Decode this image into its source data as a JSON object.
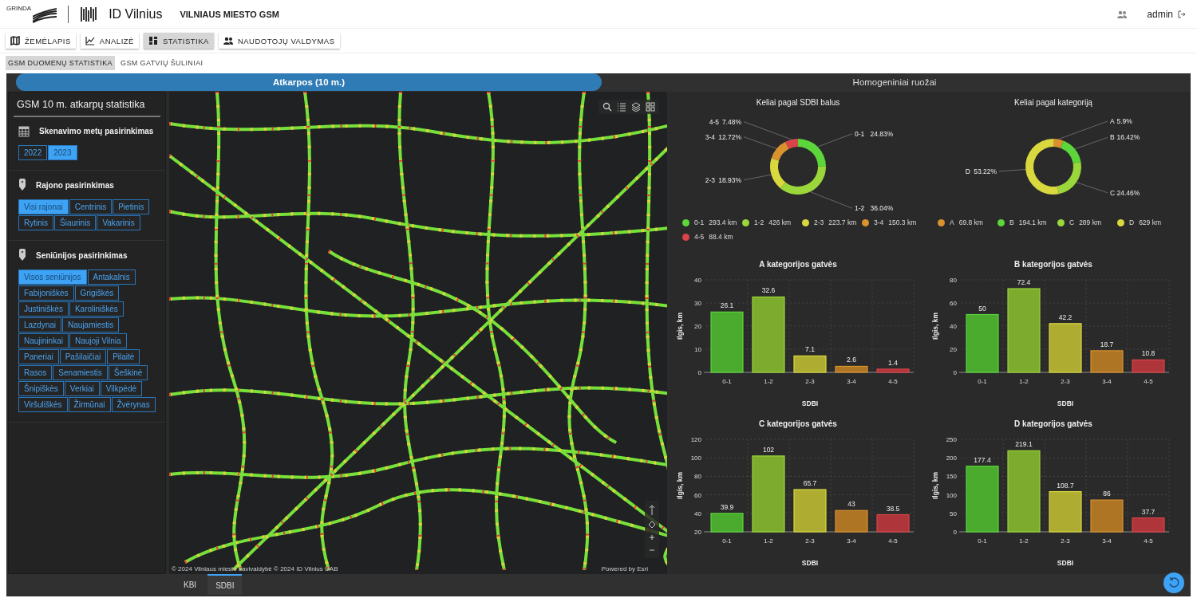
{
  "header": {
    "logo_text": "GRINDA",
    "brand": "ID Vilnius",
    "title": "VILNIAUS MIESTO GSM",
    "user": "admin"
  },
  "nav": [
    {
      "label": "ŽEMĖLAPIS",
      "selected": false
    },
    {
      "label": "ANALIZĖ",
      "selected": false
    },
    {
      "label": "STATISTIKA",
      "selected": true
    },
    {
      "label": "NAUDOTOJŲ VALDYMAS",
      "selected": false
    }
  ],
  "subtabs": [
    {
      "label": "GSM DUOMENŲ STATISTIKA",
      "selected": true
    },
    {
      "label": "GSM GATVIŲ ŠULINIAI",
      "selected": false
    }
  ],
  "view_tabs": [
    {
      "label": "Atkarpos (10 m.)",
      "selected": true
    },
    {
      "label": "Homogeniniai ruožai",
      "selected": false
    }
  ],
  "sidebar": {
    "title": "GSM 10 m. atkarpų statistika",
    "sections": [
      {
        "kind": "calendar",
        "heading": "Skenavimo metų pasirinkimas",
        "options": [
          {
            "label": "2022",
            "selected": false
          },
          {
            "label": "2023",
            "selected": true
          }
        ]
      },
      {
        "kind": "pin",
        "heading": "Rajono pasirinkimas",
        "options": [
          {
            "label": "Visi rajonai",
            "selected": true
          },
          {
            "label": "Centrinis",
            "selected": false
          },
          {
            "label": "Pietinis",
            "selected": false
          },
          {
            "label": "Rytinis",
            "selected": false
          },
          {
            "label": "Šiaurinis",
            "selected": false
          },
          {
            "label": "Vakarinis",
            "selected": false
          }
        ]
      },
      {
        "kind": "pin",
        "heading": "Seniūnijos pasirinkimas",
        "options": [
          {
            "label": "Visos seniūnijos",
            "selected": true
          },
          {
            "label": "Antakalnis",
            "selected": false
          },
          {
            "label": "Fabijoniškės",
            "selected": false
          },
          {
            "label": "Grigiškės",
            "selected": false
          },
          {
            "label": "Justiniškės",
            "selected": false
          },
          {
            "label": "Karoliniškės",
            "selected": false
          },
          {
            "label": "Lazdynai",
            "selected": false
          },
          {
            "label": "Naujamiestis",
            "selected": false
          },
          {
            "label": "Naujininkai",
            "selected": false
          },
          {
            "label": "Naujoji Vilnia",
            "selected": false
          },
          {
            "label": "Paneriai",
            "selected": false
          },
          {
            "label": "Pašilaičiai",
            "selected": false
          },
          {
            "label": "Pilaitė",
            "selected": false
          },
          {
            "label": "Rasos",
            "selected": false
          },
          {
            "label": "Senamiestis",
            "selected": false
          },
          {
            "label": "Šeškinė",
            "selected": false
          },
          {
            "label": "Šnipiškės",
            "selected": false
          },
          {
            "label": "Verkiai",
            "selected": false
          },
          {
            "label": "Vilkpėdė",
            "selected": false
          },
          {
            "label": "Viršuliškės",
            "selected": false
          },
          {
            "label": "Žirmūnai",
            "selected": false
          },
          {
            "label": "Žvėrynas",
            "selected": false
          }
        ]
      }
    ]
  },
  "map": {
    "attribution": "© 2024 Vilniaus miesto savivaldybė © 2024 ID Vilnius UAB",
    "powered_by": "Powered by Esri"
  },
  "donuts": [
    {
      "chart_data": {
        "type": "donut",
        "title": "Keliai pagal SDBI balus",
        "categories": [
          "0-1",
          "1-2",
          "2-3",
          "3-4",
          "4-5"
        ],
        "values": [
          24.83,
          36.04,
          18.93,
          12.72,
          7.48
        ],
        "value_labels": [
          "24.83%",
          "36.04%",
          "18.93%",
          "12.72%",
          "7.48%"
        ]
      },
      "legend": [
        {
          "label": "0-1",
          "value": "293.4 km",
          "color": "#5cd63a"
        },
        {
          "label": "1-2",
          "value": "426 km",
          "color": "#9bd63a"
        },
        {
          "label": "2-3",
          "value": "223.7 km",
          "color": "#d9d83e"
        },
        {
          "label": "3-4",
          "value": "150.3 km",
          "color": "#d9922e"
        },
        {
          "label": "4-5",
          "value": "88.4 km",
          "color": "#d9434a"
        }
      ]
    },
    {
      "chart_data": {
        "type": "donut",
        "title": "Keliai pagal kategoriją",
        "categories": [
          "A",
          "B",
          "C",
          "D"
        ],
        "values": [
          5.9,
          16.42,
          24.46,
          53.22
        ],
        "value_labels": [
          "5.9%",
          "16.42%",
          "24.46%",
          "53.22%"
        ]
      },
      "legend": [
        {
          "label": "A",
          "value": "69.8 km",
          "color": "#d9922e"
        },
        {
          "label": "B",
          "value": "194.1 km",
          "color": "#5cd63a"
        },
        {
          "label": "C",
          "value": "289 km",
          "color": "#9bd63a"
        },
        {
          "label": "D",
          "value": "629 km",
          "color": "#d9d83e"
        }
      ]
    }
  ],
  "bar_charts": [
    {
      "chart_data": {
        "type": "bar",
        "title": "A kategorijos gatvės",
        "xlabel": "SDBI",
        "ylabel": "Ilgis, km",
        "categories": [
          "0-1",
          "1-2",
          "2-3",
          "3-4",
          "4-5"
        ],
        "values": [
          26.1,
          32.6,
          7.1,
          2.6,
          1.4
        ],
        "grid": true,
        "ylim": [
          0,
          40
        ],
        "yticks": [
          0,
          10,
          20,
          30,
          40
        ],
        "data_labels": true
      }
    },
    {
      "chart_data": {
        "type": "bar",
        "title": "B kategorijos gatvės",
        "xlabel": "SDBI",
        "ylabel": "Ilgis, km",
        "categories": [
          "0-1",
          "1-2",
          "2-3",
          "3-4",
          "4-5"
        ],
        "values": [
          50,
          72.4,
          42.2,
          18.7,
          10.8
        ],
        "grid": true,
        "ylim": [
          0,
          80
        ],
        "yticks": [
          0,
          20,
          40,
          60,
          80
        ],
        "data_labels": true
      }
    },
    {
      "chart_data": {
        "type": "bar",
        "title": "C kategorijos gatvės",
        "xlabel": "SDBI",
        "ylabel": "Ilgis, km",
        "categories": [
          "0-1",
          "1-2",
          "2-3",
          "3-4",
          "4-5"
        ],
        "values": [
          39.9,
          102,
          65.7,
          43,
          38.5
        ],
        "grid": true,
        "ylim": [
          20,
          120
        ],
        "yticks": [
          20,
          40,
          60,
          80,
          100,
          120
        ],
        "data_labels": true
      }
    },
    {
      "chart_data": {
        "type": "bar",
        "title": "D kategorijos gatvės",
        "xlabel": "SDBI",
        "ylabel": "Ilgis, km",
        "categories": [
          "0-1",
          "1-2",
          "2-3",
          "3-4",
          "4-5"
        ],
        "values": [
          177.4,
          219.1,
          108.7,
          86,
          37.7
        ],
        "grid": true,
        "ylim": [
          0,
          250
        ],
        "yticks": [
          0,
          50,
          100,
          150,
          200,
          250
        ],
        "data_labels": true
      }
    }
  ],
  "bottom_tabs": [
    {
      "label": "KBI",
      "selected": false
    },
    {
      "label": "SDBI",
      "selected": true
    }
  ]
}
